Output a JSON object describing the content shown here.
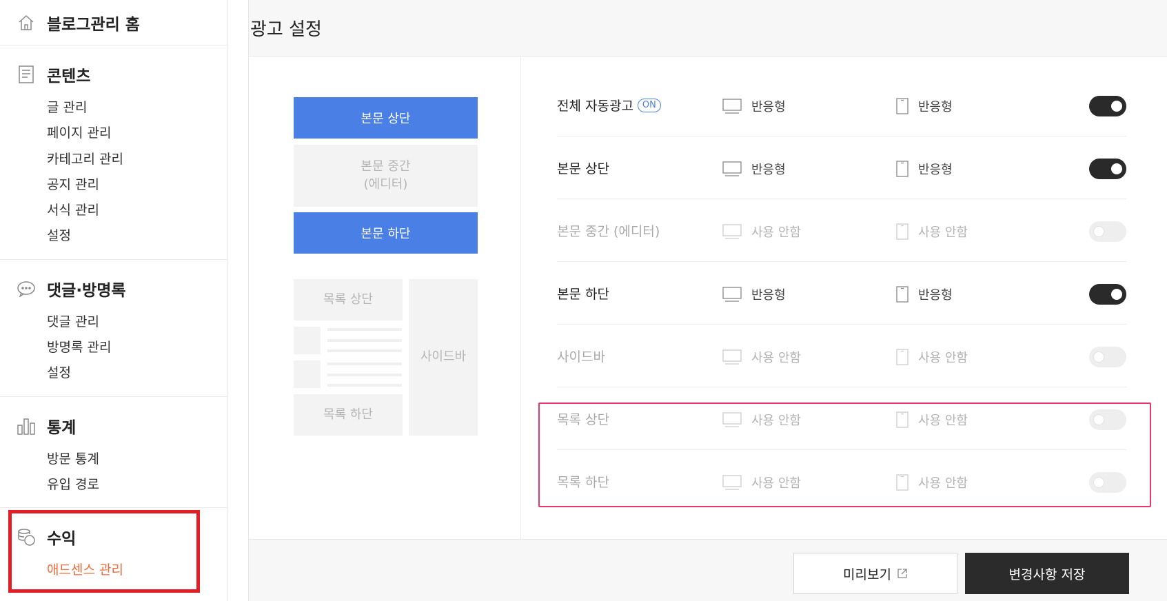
{
  "sidebar": {
    "home_label": "블로그관리 홈",
    "groups": [
      {
        "title": "콘텐츠",
        "items": [
          "글 관리",
          "페이지 관리",
          "카테고리 관리",
          "공지 관리",
          "서식 관리",
          "설정"
        ]
      },
      {
        "title": "댓글·방명록",
        "items": [
          "댓글 관리",
          "방명록 관리",
          "설정"
        ]
      },
      {
        "title": "통계",
        "items": [
          "방문 통계",
          "유입 경로"
        ]
      },
      {
        "title": "수익",
        "items": [
          "애드센스 관리"
        ]
      }
    ]
  },
  "header": {
    "title": "광고 설정"
  },
  "preview": {
    "top": "본문 상단",
    "middle_line1": "본문 중간",
    "middle_line2": "(에디터)",
    "bottom": "본문 하단",
    "list_top": "목록 상단",
    "list_bottom": "목록 하단",
    "sidebar": "사이드바"
  },
  "rows": [
    {
      "name": "전체 자동광고",
      "badge": "ON",
      "pc": "반응형",
      "mobile": "반응형",
      "enabled": true
    },
    {
      "name": "본문 상단",
      "pc": "반응형",
      "mobile": "반응형",
      "enabled": true
    },
    {
      "name": "본문 중간 (에디터)",
      "pc": "사용 안함",
      "mobile": "사용 안함",
      "enabled": false
    },
    {
      "name": "본문 하단",
      "pc": "반응형",
      "mobile": "반응형",
      "enabled": true
    },
    {
      "name": "사이드바",
      "pc": "사용 안함",
      "mobile": "사용 안함",
      "enabled": false
    },
    {
      "name": "목록 상단",
      "pc": "사용 안함",
      "mobile": "사용 안함",
      "enabled": false
    },
    {
      "name": "목록 하단",
      "pc": "사용 안함",
      "mobile": "사용 안함",
      "enabled": false
    }
  ],
  "footer": {
    "preview_label": "미리보기",
    "save_label": "변경사항 저장"
  },
  "colors": {
    "accent": "#4a80e6",
    "active_menu": "#f26b3a",
    "highlight_red": "#e41e25",
    "highlight_pink": "#e8356c",
    "toggle_on": "#2a2a2a"
  }
}
